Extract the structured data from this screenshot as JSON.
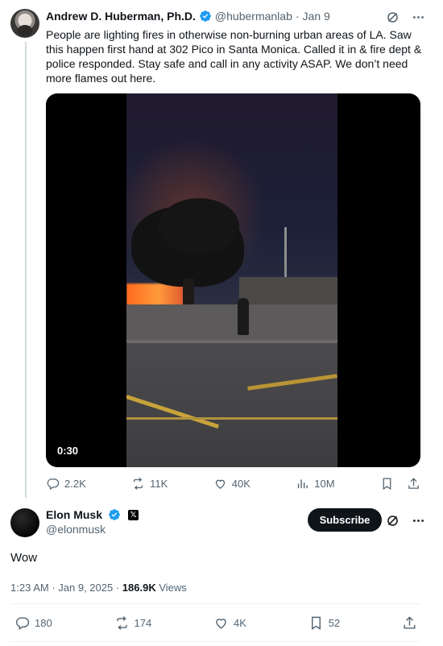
{
  "quoted": {
    "name": "Andrew D. Huberman, Ph.D.",
    "handle": "@hubermanlab",
    "separator": "·",
    "date": "Jan 9",
    "text": "People are lighting fires in otherwise non-burning urban areas of LA. Saw this happen first hand at 302 Pico in Santa Monica. Called it in & fire dept & police responded. Stay safe and call in any activity ASAP. We don’t need more flames out here.",
    "video_duration": "0:30",
    "stats": {
      "replies": "2.2K",
      "reposts": "11K",
      "likes": "40K",
      "views": "10M"
    }
  },
  "main": {
    "name": "Elon Musk",
    "handle": "@elonmusk",
    "subscribe_label": "Subscribe",
    "text": "Wow",
    "time": "1:23 AM",
    "separator": " · ",
    "date": "Jan 9, 2025",
    "views_count": "186.9K",
    "views_label": "Views",
    "stats": {
      "replies": "180",
      "reposts": "174",
      "likes": "4K",
      "bookmarks": "52"
    }
  },
  "colors": {
    "verified": "#1d9bf0",
    "text": "#0f1419",
    "muted": "#536471"
  },
  "icons": [
    "grok-icon",
    "more-icon",
    "reply-icon",
    "repost-icon",
    "like-icon",
    "views-icon",
    "bookmark-icon",
    "share-icon",
    "verified-badge-icon",
    "x-affiliate-icon"
  ]
}
